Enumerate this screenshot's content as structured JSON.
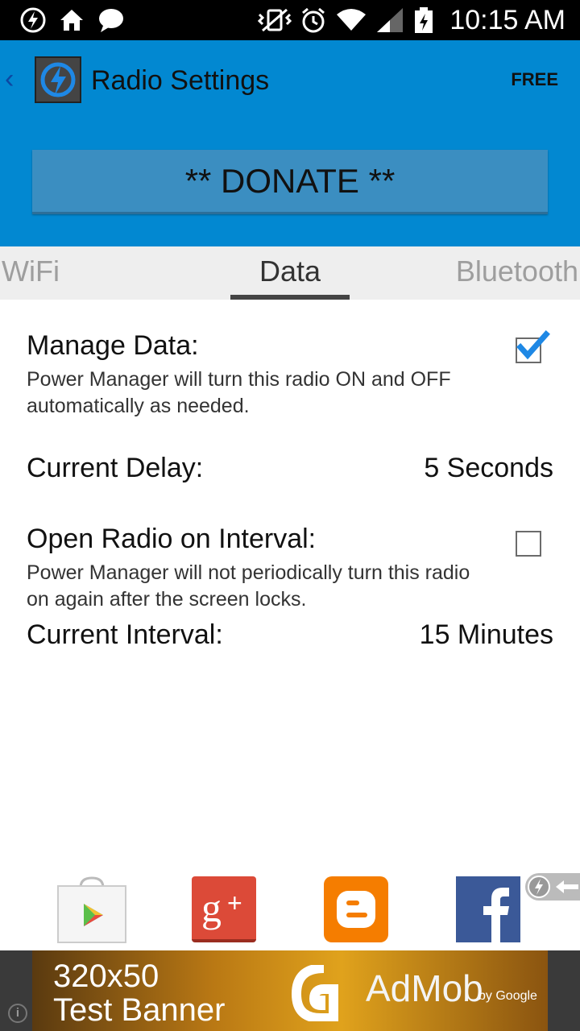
{
  "status_bar": {
    "time": "10:15 AM",
    "icons": [
      "power-manager-icon",
      "home-icon",
      "chat-icon",
      "vibrate-icon",
      "alarm-icon",
      "wifi-icon",
      "signal-icon",
      "battery-charging-icon"
    ]
  },
  "app_bar": {
    "title": "Radio Settings",
    "badge": "FREE",
    "donate_label": "** DONATE **",
    "accent_color": "#0288d1"
  },
  "tabs": {
    "items": [
      {
        "label": "WiFi",
        "selected": false
      },
      {
        "label": "Data",
        "selected": true
      },
      {
        "label": "Bluetooth",
        "selected": false
      }
    ]
  },
  "settings": {
    "manage_data": {
      "title": "Manage Data:",
      "description": "Power Manager will turn this radio ON and OFF automatically as needed.",
      "checked": true
    },
    "current_delay": {
      "label": "Current Delay:",
      "value": "5 Seconds"
    },
    "open_radio": {
      "title": "Open Radio on Interval:",
      "description": "Power Manager will not periodically turn this radio on again after the screen locks.",
      "checked": false
    },
    "current_interval": {
      "label": "Current Interval:",
      "value": "15 Minutes"
    }
  },
  "social_links": [
    "google-play-icon",
    "google-plus-icon",
    "blogger-icon",
    "facebook-icon"
  ],
  "ad_banner": {
    "line1": "320x50",
    "line2": "Test Banner",
    "brand": "AdMob",
    "brand_sub": "by Google"
  }
}
